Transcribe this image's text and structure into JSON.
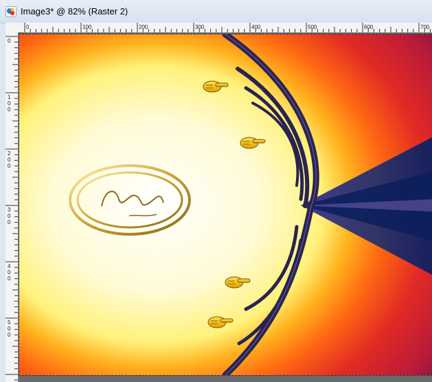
{
  "window": {
    "title": "Image3* @  82% (Raster 2)"
  },
  "ruler": {
    "horizontal_labels": [
      "0",
      "100",
      "200",
      "300",
      "400",
      "500",
      "600",
      "700"
    ],
    "vertical_labels": [
      "0",
      "100",
      "200",
      "300",
      "400",
      "500"
    ]
  },
  "canvas": {
    "layer": "Raster 2",
    "zoom_percent": 82,
    "selection": "marching-ants border",
    "gradient_colors": [
      "#ffffff",
      "#fff48a",
      "#ff8a1a",
      "#d61f2a",
      "#7a1545",
      "#122a6b"
    ],
    "watermark_note": "Nadège M signature in gold double oval",
    "pointer_icons": [
      "pointing-hand-icon",
      "pointing-hand-icon",
      "pointing-hand-icon",
      "pointing-hand-icon"
    ]
  },
  "colors": {
    "titlebar": "#dce6f2",
    "frame": "#6a6a6a",
    "ruler": "#f4f4f4"
  }
}
